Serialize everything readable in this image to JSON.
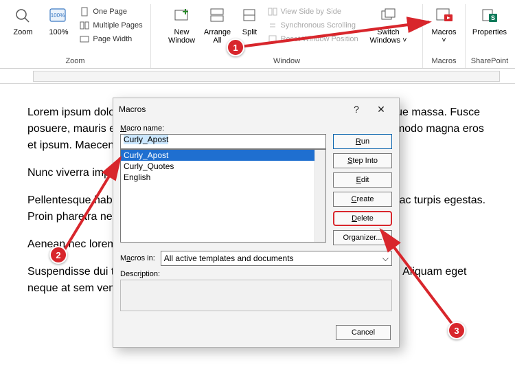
{
  "ribbon": {
    "zoom_group": {
      "zoom": "Zoom",
      "hundred": "100%",
      "one_page": "One Page",
      "multiple": "Multiple Pages",
      "page_width": "Page Width",
      "label": "Zoom"
    },
    "window_group": {
      "new_window": "New\nWindow",
      "arrange_all": "Arrange\nAll",
      "split": "Split",
      "side": "View Side by Side",
      "sync": "Synchronous Scrolling",
      "reset": "Reset Window Position",
      "switch": "Switch\nWindows",
      "label": "Window"
    },
    "macros_group": {
      "macros": "Macros",
      "label": "Macros"
    },
    "sp_group": {
      "properties": "Properties",
      "label": "SharePoint"
    }
  },
  "doc": {
    "p1": "Lorem ipsum dolor sit amet, consectetur adipiscing elit. Curabitur vitae congue massa. Fusce posuere, mauris eget aliquam porta, mauris urna efficitur eros, sit amet commodo magna eros et ipsum. Maecenas pulvinar sed ante at placerat.",
    "p2": "Nunc viverra imperdiet est, sed aliquam justo iaculis at.",
    "p3": "Pellentesque habitant morbi tristique senectus et netus et malesuada fames ac turpis egestas. Proin pharetra nec sapien convallis suscipit.",
    "p4": "Aenean nec lorem auctor, condimentum neque sit amet, aliquam risus.",
    "p5": "Suspendisse dui turpis, condimentum nec sapien quis, pharetra auctor nunc. Aliquam eget neque at sem venenatis faucibus at a augue."
  },
  "dialog": {
    "title": "Macros",
    "macro_name_label": "Macro name:",
    "input_value": "Curly_Apost",
    "options": [
      "Curly_Apost",
      "Curly_Quotes",
      "English"
    ],
    "run": "Run",
    "step_into": "Step Into",
    "edit": "Edit",
    "create": "Create",
    "delete": "Delete",
    "organizer": "Organizer...",
    "macros_in_label": "Macros in:",
    "macros_in_value": "All active templates and documents",
    "description_label": "Description:",
    "cancel": "Cancel",
    "help": "?",
    "close": "✕"
  },
  "annotations": {
    "m1": "1",
    "m2": "2",
    "m3": "3"
  }
}
